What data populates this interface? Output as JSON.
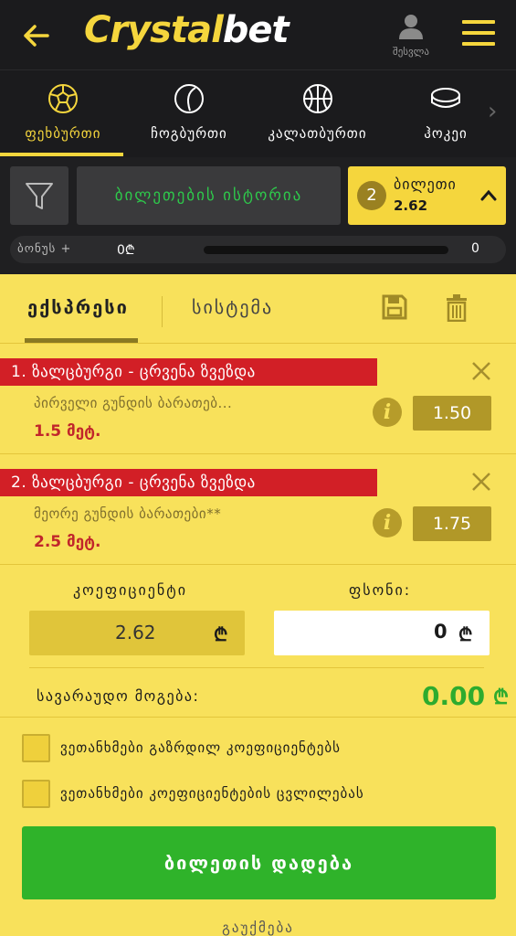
{
  "header": {
    "logo_left": "Crystal",
    "logo_right": "bet",
    "login_label": "შესვლა"
  },
  "sports": {
    "items": [
      {
        "label": "ფეხბურთი",
        "icon": "soccer-ball-icon",
        "active": true
      },
      {
        "label": "ჩოგბურთი",
        "icon": "tennis-ball-icon",
        "active": false
      },
      {
        "label": "კალათბურთი",
        "icon": "basketball-icon",
        "active": false
      },
      {
        "label": "ჰოკეი",
        "icon": "hockey-puck-icon",
        "active": false
      }
    ]
  },
  "toolbar": {
    "history_label": "ბილეთების ისტორია",
    "ticket_count": "2",
    "ticket_label": "ბილეთი",
    "ticket_value": "2.62",
    "bonus_label": "ბონუს +",
    "bonus_amount": "0₾",
    "bonus_count": "0"
  },
  "slip": {
    "tab_express": "ექსპრესი",
    "tab_system": "სისტემა",
    "bets": [
      {
        "title": "1.  ზალცბურგი - ცრვენა ზვეზდა",
        "market": "პირველი გუნდის ბარათებ...",
        "selection": "1.5 მეტ.",
        "odds": "1.50"
      },
      {
        "title": "2.  ზალცბურგი - ცრვენა ზვეზდა",
        "market": "მეორე გუნდის ბარათები**",
        "selection": "2.5 მეტ.",
        "odds": "1.75"
      }
    ],
    "coef_label": "კოეფიციენტი",
    "coef_value": "2.62",
    "stake_label": "ფსონი:",
    "stake_value": "0",
    "currency": "₾",
    "win_label": "სავარაუდო მოგება:",
    "win_value": "0.00",
    "check_increased": "ვეთანხმები გაზრდილ კოეფიციენტებს",
    "check_changes": "ვეთანხმები კოეფიციენტების ცვლილებას",
    "place_button": "ბილეთის დადება",
    "cancel_link": "გაუქმება"
  },
  "colors": {
    "accent": "#f5d63d",
    "panel": "#f8e15b",
    "danger": "#d21f26",
    "success": "#2fb32a"
  }
}
